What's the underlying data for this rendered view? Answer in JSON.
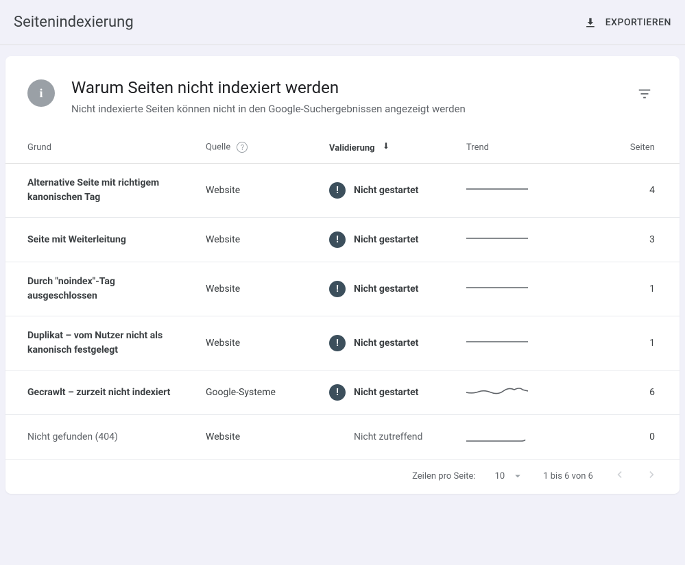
{
  "topbar": {
    "title": "Seitenindexierung",
    "export_label": "EXPORTIEREN"
  },
  "card": {
    "title": "Warum Seiten nicht indexiert werden",
    "subtitle": "Nicht indexierte Seiten können nicht in den Google-Suchergebnissen angezeigt werden"
  },
  "columns": {
    "reason": "Grund",
    "source": "Quelle",
    "validation": "Validierung",
    "trend": "Trend",
    "pages": "Seiten"
  },
  "status": {
    "not_started": "Nicht gestartet",
    "na": "Nicht zutreffend"
  },
  "rows": [
    {
      "reason": "Alternative Seite mit richtigem kanonischen Tag",
      "source": "Website",
      "validation": "not_started",
      "pages": "4",
      "spark": "flat"
    },
    {
      "reason": "Seite mit Weiterleitung",
      "source": "Website",
      "validation": "not_started",
      "pages": "3",
      "spark": "flat"
    },
    {
      "reason": "Durch \"noindex\"-Tag ausgeschlossen",
      "source": "Website",
      "validation": "not_started",
      "pages": "1",
      "spark": "flat"
    },
    {
      "reason": "Duplikat – vom Nutzer nicht als kanonisch festgelegt",
      "source": "Website",
      "validation": "not_started",
      "pages": "1",
      "spark": "flat"
    },
    {
      "reason": "Gecrawlt – zurzeit nicht indexiert",
      "source": "Google-Systeme",
      "validation": "not_started",
      "pages": "6",
      "spark": "wavy"
    },
    {
      "reason": "Nicht gefunden (404)",
      "source": "Website",
      "validation": "na",
      "pages": "0",
      "spark": "low",
      "muted": true
    }
  ],
  "pagination": {
    "rows_per_page_label": "Zeilen pro Seite:",
    "rows_per_page_value": "10",
    "range": "1 bis 6 von 6"
  }
}
